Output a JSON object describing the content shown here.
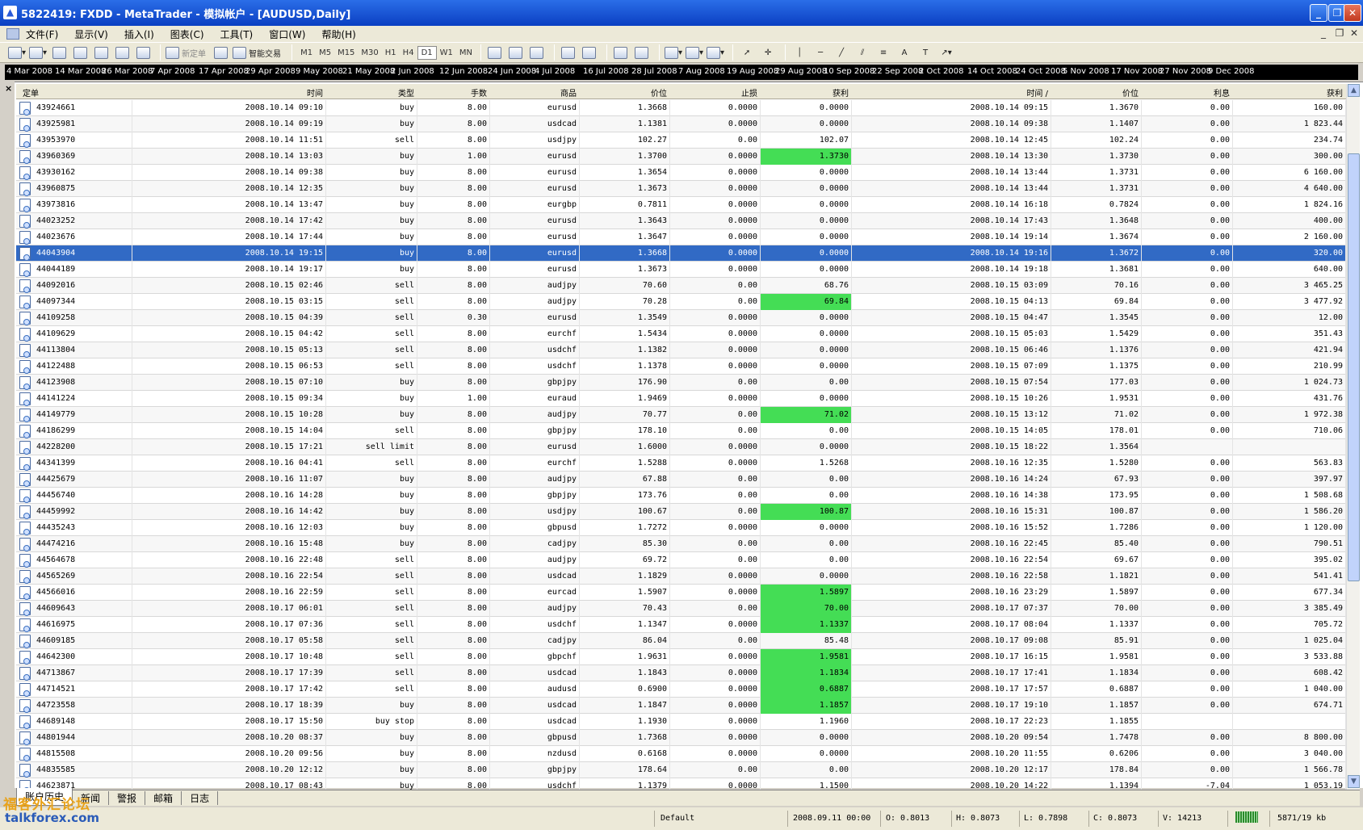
{
  "window": {
    "title": "5822419: FXDD - MetaTrader - 模拟帐户 - [AUDUSD,Daily]"
  },
  "menu": [
    "文件(F)",
    "显示(V)",
    "插入(I)",
    "图表(C)",
    "工具(T)",
    "窗口(W)",
    "帮助(H)"
  ],
  "toolbar": {
    "new_order": "新定单",
    "expert": "智能交易",
    "timeframes": [
      "M1",
      "M5",
      "M15",
      "M30",
      "H1",
      "H4",
      "D1",
      "W1",
      "MN"
    ],
    "active_timeframe": "D1"
  },
  "time_axis": [
    "4 Mar 2008",
    "14 Mar 2008",
    "26 Mar 2008",
    "7 Apr 2008",
    "17 Apr 2008",
    "29 Apr 2008",
    "9 May 2008",
    "21 May 2008",
    "2 Jun 2008",
    "12 Jun 2008",
    "24 Jun 2008",
    "4 Jul 2008",
    "16 Jul 2008",
    "28 Jul 2008",
    "7 Aug 2008",
    "19 Aug 2008",
    "29 Aug 2008",
    "10 Sep 2008",
    "22 Sep 2008",
    "2 Oct 2008",
    "14 Oct 2008",
    "24 Oct 2008",
    "5 Nov 2008",
    "17 Nov 2008",
    "27 Nov 2008",
    "9 Dec 2008"
  ],
  "columns": [
    "定单",
    "时间",
    "类型",
    "手数",
    "商品",
    "价位",
    "止损",
    "获利",
    "时间 /",
    "价位",
    "利息",
    "获利"
  ],
  "rows": [
    [
      "43924661",
      "2008.10.14 09:10",
      "buy",
      "8.00",
      "eurusd",
      "1.3668",
      "0.0000",
      "0.0000",
      "2008.10.14 09:15",
      "1.3670",
      "0.00",
      "160.00"
    ],
    [
      "43925981",
      "2008.10.14 09:19",
      "buy",
      "8.00",
      "usdcad",
      "1.1381",
      "0.0000",
      "0.0000",
      "2008.10.14 09:38",
      "1.1407",
      "0.00",
      "1 823.44"
    ],
    [
      "43953970",
      "2008.10.14 11:51",
      "sell",
      "8.00",
      "usdjpy",
      "102.27",
      "0.00",
      "102.07",
      "2008.10.14 12:45",
      "102.24",
      "0.00",
      "234.74"
    ],
    [
      "43960369",
      "2008.10.14 13:03",
      "buy",
      "1.00",
      "eurusd",
      "1.3700",
      "0.0000",
      "1.3730",
      "2008.10.14 13:30",
      "1.3730",
      "0.00",
      "300.00"
    ],
    [
      "43930162",
      "2008.10.14 09:38",
      "buy",
      "8.00",
      "eurusd",
      "1.3654",
      "0.0000",
      "0.0000",
      "2008.10.14 13:44",
      "1.3731",
      "0.00",
      "6 160.00"
    ],
    [
      "43960875",
      "2008.10.14 12:35",
      "buy",
      "8.00",
      "eurusd",
      "1.3673",
      "0.0000",
      "0.0000",
      "2008.10.14 13:44",
      "1.3731",
      "0.00",
      "4 640.00"
    ],
    [
      "43973816",
      "2008.10.14 13:47",
      "buy",
      "8.00",
      "eurgbp",
      "0.7811",
      "0.0000",
      "0.0000",
      "2008.10.14 16:18",
      "0.7824",
      "0.00",
      "1 824.16"
    ],
    [
      "44023252",
      "2008.10.14 17:42",
      "buy",
      "8.00",
      "eurusd",
      "1.3643",
      "0.0000",
      "0.0000",
      "2008.10.14 17:43",
      "1.3648",
      "0.00",
      "400.00"
    ],
    [
      "44023676",
      "2008.10.14 17:44",
      "buy",
      "8.00",
      "eurusd",
      "1.3647",
      "0.0000",
      "0.0000",
      "2008.10.14 19:14",
      "1.3674",
      "0.00",
      "2 160.00"
    ],
    [
      "44043904",
      "2008.10.14 19:15",
      "buy",
      "8.00",
      "eurusd",
      "1.3668",
      "0.0000",
      "0.0000",
      "2008.10.14 19:16",
      "1.3672",
      "0.00",
      "320.00"
    ],
    [
      "44044189",
      "2008.10.14 19:17",
      "buy",
      "8.00",
      "eurusd",
      "1.3673",
      "0.0000",
      "0.0000",
      "2008.10.14 19:18",
      "1.3681",
      "0.00",
      "640.00"
    ],
    [
      "44092016",
      "2008.10.15 02:46",
      "sell",
      "8.00",
      "audjpy",
      "70.60",
      "0.00",
      "68.76",
      "2008.10.15 03:09",
      "70.16",
      "0.00",
      "3 465.25"
    ],
    [
      "44097344",
      "2008.10.15 03:15",
      "sell",
      "8.00",
      "audjpy",
      "70.28",
      "0.00",
      "69.84",
      "2008.10.15 04:13",
      "69.84",
      "0.00",
      "3 477.92"
    ],
    [
      "44109258",
      "2008.10.15 04:39",
      "sell",
      "0.30",
      "eurusd",
      "1.3549",
      "0.0000",
      "0.0000",
      "2008.10.15 04:47",
      "1.3545",
      "0.00",
      "12.00"
    ],
    [
      "44109629",
      "2008.10.15 04:42",
      "sell",
      "8.00",
      "eurchf",
      "1.5434",
      "0.0000",
      "0.0000",
      "2008.10.15 05:03",
      "1.5429",
      "0.00",
      "351.43"
    ],
    [
      "44113804",
      "2008.10.15 05:13",
      "sell",
      "8.00",
      "usdchf",
      "1.1382",
      "0.0000",
      "0.0000",
      "2008.10.15 06:46",
      "1.1376",
      "0.00",
      "421.94"
    ],
    [
      "44122488",
      "2008.10.15 06:53",
      "sell",
      "8.00",
      "usdchf",
      "1.1378",
      "0.0000",
      "0.0000",
      "2008.10.15 07:09",
      "1.1375",
      "0.00",
      "210.99"
    ],
    [
      "44123908",
      "2008.10.15 07:10",
      "buy",
      "8.00",
      "gbpjpy",
      "176.90",
      "0.00",
      "0.00",
      "2008.10.15 07:54",
      "177.03",
      "0.00",
      "1 024.73"
    ],
    [
      "44141224",
      "2008.10.15 09:34",
      "buy",
      "1.00",
      "euraud",
      "1.9469",
      "0.0000",
      "0.0000",
      "2008.10.15 10:26",
      "1.9531",
      "0.00",
      "431.76"
    ],
    [
      "44149779",
      "2008.10.15 10:28",
      "buy",
      "8.00",
      "audjpy",
      "70.77",
      "0.00",
      "71.02",
      "2008.10.15 13:12",
      "71.02",
      "0.00",
      "1 972.38"
    ],
    [
      "44186299",
      "2008.10.15 14:04",
      "sell",
      "8.00",
      "gbpjpy",
      "178.10",
      "0.00",
      "0.00",
      "2008.10.15 14:05",
      "178.01",
      "0.00",
      "710.06"
    ],
    [
      "44228200",
      "2008.10.15 17:21",
      "sell limit",
      "8.00",
      "eurusd",
      "1.6000",
      "0.0000",
      "0.0000",
      "2008.10.15 18:22",
      "1.3564",
      "",
      ""
    ],
    [
      "44341399",
      "2008.10.16 04:41",
      "sell",
      "8.00",
      "eurchf",
      "1.5288",
      "0.0000",
      "1.5268",
      "2008.10.16 12:35",
      "1.5280",
      "0.00",
      "563.83"
    ],
    [
      "44425679",
      "2008.10.16 11:07",
      "buy",
      "8.00",
      "audjpy",
      "67.88",
      "0.00",
      "0.00",
      "2008.10.16 14:24",
      "67.93",
      "0.00",
      "397.97"
    ],
    [
      "44456740",
      "2008.10.16 14:28",
      "buy",
      "8.00",
      "gbpjpy",
      "173.76",
      "0.00",
      "0.00",
      "2008.10.16 14:38",
      "173.95",
      "0.00",
      "1 508.68"
    ],
    [
      "44459992",
      "2008.10.16 14:42",
      "buy",
      "8.00",
      "usdjpy",
      "100.67",
      "0.00",
      "100.87",
      "2008.10.16 15:31",
      "100.87",
      "0.00",
      "1 586.20"
    ],
    [
      "44435243",
      "2008.10.16 12:03",
      "buy",
      "8.00",
      "gbpusd",
      "1.7272",
      "0.0000",
      "0.0000",
      "2008.10.16 15:52",
      "1.7286",
      "0.00",
      "1 120.00"
    ],
    [
      "44474216",
      "2008.10.16 15:48",
      "buy",
      "8.00",
      "cadjpy",
      "85.30",
      "0.00",
      "0.00",
      "2008.10.16 22:45",
      "85.40",
      "0.00",
      "790.51"
    ],
    [
      "44564678",
      "2008.10.16 22:48",
      "sell",
      "8.00",
      "audjpy",
      "69.72",
      "0.00",
      "0.00",
      "2008.10.16 22:54",
      "69.67",
      "0.00",
      "395.02"
    ],
    [
      "44565269",
      "2008.10.16 22:54",
      "sell",
      "8.00",
      "usdcad",
      "1.1829",
      "0.0000",
      "0.0000",
      "2008.10.16 22:58",
      "1.1821",
      "0.00",
      "541.41"
    ],
    [
      "44566016",
      "2008.10.16 22:59",
      "sell",
      "8.00",
      "eurcad",
      "1.5907",
      "0.0000",
      "1.5897",
      "2008.10.16 23:29",
      "1.5897",
      "0.00",
      "677.34"
    ],
    [
      "44609643",
      "2008.10.17 06:01",
      "sell",
      "8.00",
      "audjpy",
      "70.43",
      "0.00",
      "70.00",
      "2008.10.17 07:37",
      "70.00",
      "0.00",
      "3 385.49"
    ],
    [
      "44616975",
      "2008.10.17 07:36",
      "sell",
      "8.00",
      "usdchf",
      "1.1347",
      "0.0000",
      "1.1337",
      "2008.10.17 08:04",
      "1.1337",
      "0.00",
      "705.72"
    ],
    [
      "44609185",
      "2008.10.17 05:58",
      "sell",
      "8.00",
      "cadjpy",
      "86.04",
      "0.00",
      "85.48",
      "2008.10.17 09:08",
      "85.91",
      "0.00",
      "1 025.04"
    ],
    [
      "44642300",
      "2008.10.17 10:48",
      "sell",
      "8.00",
      "gbpchf",
      "1.9631",
      "0.0000",
      "1.9581",
      "2008.10.17 16:15",
      "1.9581",
      "0.00",
      "3 533.88"
    ],
    [
      "44713867",
      "2008.10.17 17:39",
      "sell",
      "8.00",
      "usdcad",
      "1.1843",
      "0.0000",
      "1.1834",
      "2008.10.17 17:41",
      "1.1834",
      "0.00",
      "608.42"
    ],
    [
      "44714521",
      "2008.10.17 17:42",
      "sell",
      "8.00",
      "audusd",
      "0.6900",
      "0.0000",
      "0.6887",
      "2008.10.17 17:57",
      "0.6887",
      "0.00",
      "1 040.00"
    ],
    [
      "44723558",
      "2008.10.17 18:39",
      "buy",
      "8.00",
      "usdcad",
      "1.1847",
      "0.0000",
      "1.1857",
      "2008.10.17 19:10",
      "1.1857",
      "0.00",
      "674.71"
    ],
    [
      "44689148",
      "2008.10.17 15:50",
      "buy stop",
      "8.00",
      "usdcad",
      "1.1930",
      "0.0000",
      "1.1960",
      "2008.10.17 22:23",
      "1.1855",
      "",
      ""
    ],
    [
      "44801944",
      "2008.10.20 08:37",
      "buy",
      "8.00",
      "gbpusd",
      "1.7368",
      "0.0000",
      "0.0000",
      "2008.10.20 09:54",
      "1.7478",
      "0.00",
      "8 800.00"
    ],
    [
      "44815508",
      "2008.10.20 09:56",
      "buy",
      "8.00",
      "nzdusd",
      "0.6168",
      "0.0000",
      "0.0000",
      "2008.10.20 11:55",
      "0.6206",
      "0.00",
      "3 040.00"
    ],
    [
      "44835585",
      "2008.10.20 12:12",
      "buy",
      "8.00",
      "gbpjpy",
      "178.64",
      "0.00",
      "0.00",
      "2008.10.20 12:17",
      "178.84",
      "0.00",
      "1 566.78"
    ],
    [
      "44623871",
      "2008.10.17 08:43",
      "buy",
      "8.00",
      "usdchf",
      "1.1379",
      "0.0000",
      "1.1500",
      "2008.10.20 14:22",
      "1.1394",
      "-7.04",
      "1 053.19"
    ]
  ],
  "selected_row": 9,
  "green_tp_rows": [
    3,
    12,
    19,
    25,
    30,
    31,
    32,
    34,
    35,
    36,
    37
  ],
  "tabs": [
    "账户历史",
    "新闻",
    "警报",
    "邮箱",
    "日志"
  ],
  "active_tab": "账户历史",
  "status": {
    "profile": "Default",
    "datetime": "2008.09.11 00:00",
    "open": "O: 0.8013",
    "high": "H: 0.8073",
    "low": "L: 0.7898",
    "close": "C: 0.8073",
    "volume": "V: 14213",
    "traffic": "5871/19 kb"
  },
  "watermark": {
    "cn": "福客外汇论坛",
    "url": "talkforex.com"
  },
  "colors": {
    "selected": "#316ac5",
    "green_highlight": "#44dd55",
    "titlebar": "#0a3fc2"
  }
}
